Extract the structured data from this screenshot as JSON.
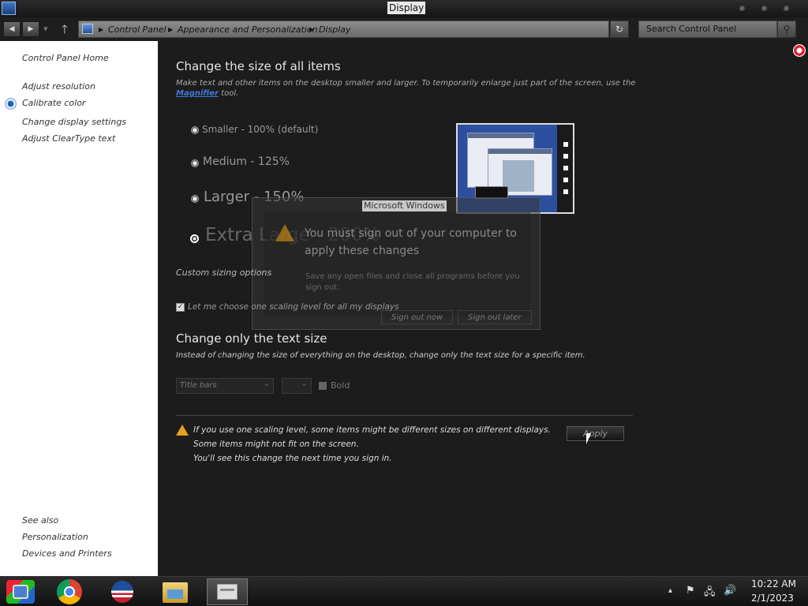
{
  "window": {
    "title": "Display"
  },
  "nav": {
    "back": "◀",
    "forward": "▶",
    "recent": "▾",
    "up": "🡑",
    "breadcrumbs": [
      "Control Panel",
      "Appearance and Personalization",
      "Display"
    ],
    "refresh": "↻",
    "search_placeholder": "Search Control Panel",
    "search_icon": "⚲"
  },
  "sidebar": {
    "home": "Control Panel Home",
    "links": [
      "Adjust resolution",
      "Calibrate color",
      "Change display settings",
      "Adjust ClearType text"
    ],
    "see_also_heading": "See also",
    "see_also": [
      "Personalization",
      "Devices and Printers"
    ]
  },
  "main": {
    "heading": "Change the size of all items",
    "description_1": "Make text and other items on the desktop smaller and larger. To temporarily enlarge just part of the screen, use the",
    "magnifier_link": "Magnifier",
    "description_2": " tool.",
    "options": [
      {
        "label": "Smaller - 100% (default)",
        "selected": false
      },
      {
        "label": "Medium - 125%",
        "selected": false
      },
      {
        "label": "Larger - 150%",
        "selected": false
      },
      {
        "label": "Extra Large - 200%",
        "selected": true
      }
    ],
    "custom_sizing": "Custom sizing options",
    "checkbox_label": "Let me choose one scaling level for all my displays",
    "checkbox_checked": true,
    "text_size_heading": "Change only the text size",
    "text_size_desc": "Instead of changing the size of everything on the desktop, change only the text size for a specific item.",
    "item_select": "Title bars",
    "size_select": "",
    "bold_label": "Bold",
    "notes": [
      "If you use one scaling level, some items might be different sizes on different displays.",
      "Some items might not fit on the screen.",
      "You'll see this change the next time you sign in."
    ],
    "apply_label": "Apply"
  },
  "dialog": {
    "title": "Microsoft Windows",
    "message": "You must sign out of your computer to",
    "message_2": "apply these changes",
    "detail": "Save any open files and close all programs before you",
    "detail_2": "sign out.",
    "sign_out_now": "Sign out now",
    "sign_out_later": "Sign out later"
  },
  "taskbar": {
    "time": "10:22 AM",
    "date": "2/1/2023",
    "tray_icons": [
      "▴",
      "⚑",
      "🖧",
      "🔊"
    ]
  },
  "colors": {
    "background": "#1c1c1c",
    "link": "#3d7be0",
    "warning": "#e8a020"
  }
}
